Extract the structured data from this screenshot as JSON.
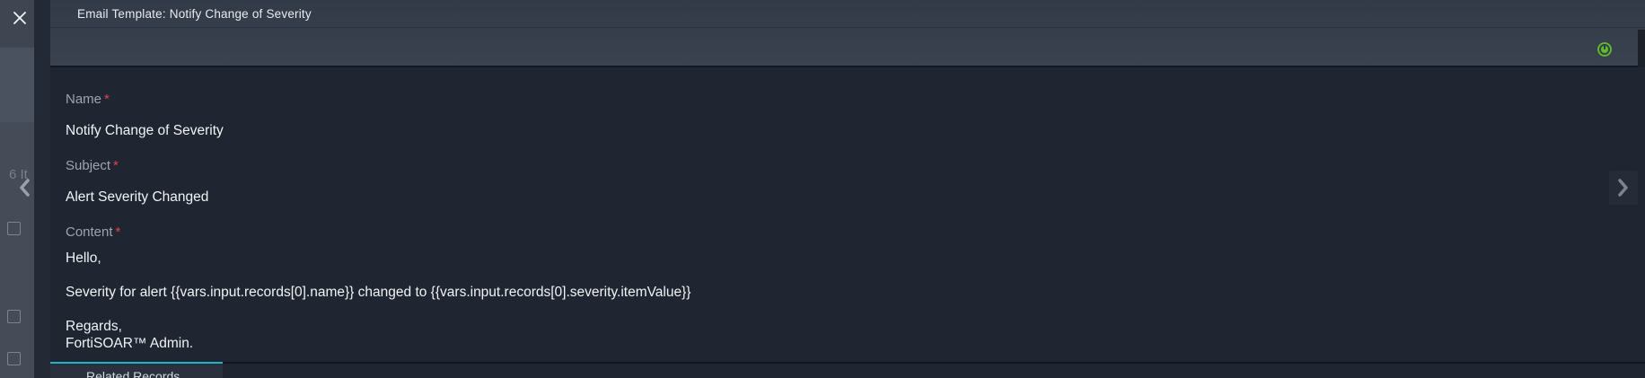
{
  "window": {
    "title": "Email Template: Notify Change of Severity"
  },
  "background": {
    "count_text": "6 It"
  },
  "fields": {
    "name": {
      "label": "Name",
      "required_mark": "*",
      "value": "Notify Change of Severity"
    },
    "subject": {
      "label": "Subject",
      "required_mark": "*",
      "value": "Alert Severity Changed"
    },
    "content": {
      "label": "Content",
      "required_mark": "*",
      "lines": [
        "Hello,",
        "Severity for alert {{vars.input.records[0].name}} changed to {{vars.input.records[0].severity.itemValue}}",
        "Regards,",
        "FortiSOAR™ Admin."
      ]
    }
  },
  "footer": {
    "tab_label": "Related Records"
  },
  "icons": {
    "close": "close-icon",
    "status": "status-icon",
    "prev": "chevron-left-icon",
    "next": "chevron-right-icon"
  },
  "colors": {
    "accent": "#22b3c8",
    "required": "#e0424a",
    "status": "#5fbf2a"
  }
}
